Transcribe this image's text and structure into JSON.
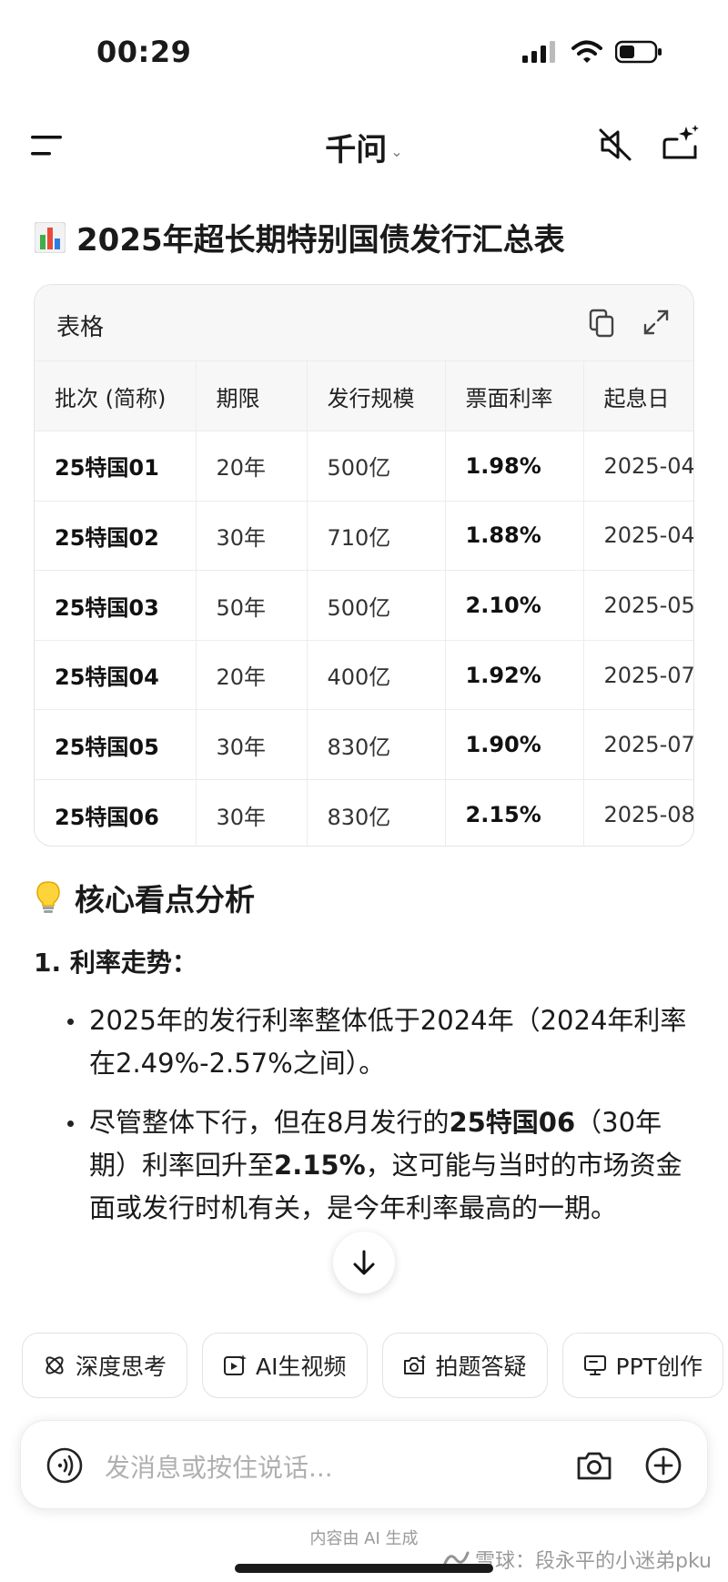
{
  "status": {
    "time": "00:29"
  },
  "nav": {
    "title": "千问",
    "chevron": "⌄"
  },
  "heading1": {
    "emoji": "📊",
    "text": "2025年超长期特别国债发行汇总表"
  },
  "table": {
    "card_title": "表格",
    "columns": [
      "批次 (简称)",
      "期限",
      "发行规模",
      "票面利率",
      "起息日"
    ],
    "rows": [
      [
        "25特国01",
        "20年",
        "500亿",
        "1.98%",
        "2025-04"
      ],
      [
        "25特国02",
        "30年",
        "710亿",
        "1.88%",
        "2025-04"
      ],
      [
        "25特国03",
        "50年",
        "500亿",
        "2.10%",
        "2025-05"
      ],
      [
        "25特国04",
        "20年",
        "400亿",
        "1.92%",
        "2025-07"
      ],
      [
        "25特国05",
        "30年",
        "830亿",
        "1.90%",
        "2025-07"
      ],
      [
        "25特国06",
        "30年",
        "830亿",
        "2.15%",
        "2025-08"
      ]
    ]
  },
  "analysis": {
    "emoji": "💡",
    "heading": "核心看点分析",
    "point1_title": "1. 利率走势：",
    "bullet1": "2025年的发行利率整体低于2024年（2024年利率在2.49%-2.57%之间）。",
    "bullet2_pre": "尽管整体下行，但在8月发行的",
    "bullet2_bold1": "25特国06",
    "bullet2_mid": "（30年期）利率回升至",
    "bullet2_bold2": "2.15%",
    "bullet2_post": "，这可能与当时的市场资金面或发行时机有关，是今年利率最高的一期。"
  },
  "chips": [
    {
      "label": "深度思考",
      "icon": "think-icon"
    },
    {
      "label": "AI生视频",
      "icon": "video-icon"
    },
    {
      "label": "拍题答疑",
      "icon": "camera-question-icon"
    },
    {
      "label": "PPT创作",
      "icon": "ppt-icon"
    }
  ],
  "input": {
    "placeholder": "发消息或按住说话..."
  },
  "footer": {
    "note": "内容由 AI 生成",
    "watermark": "雪球：段永平的小迷弟pku"
  }
}
